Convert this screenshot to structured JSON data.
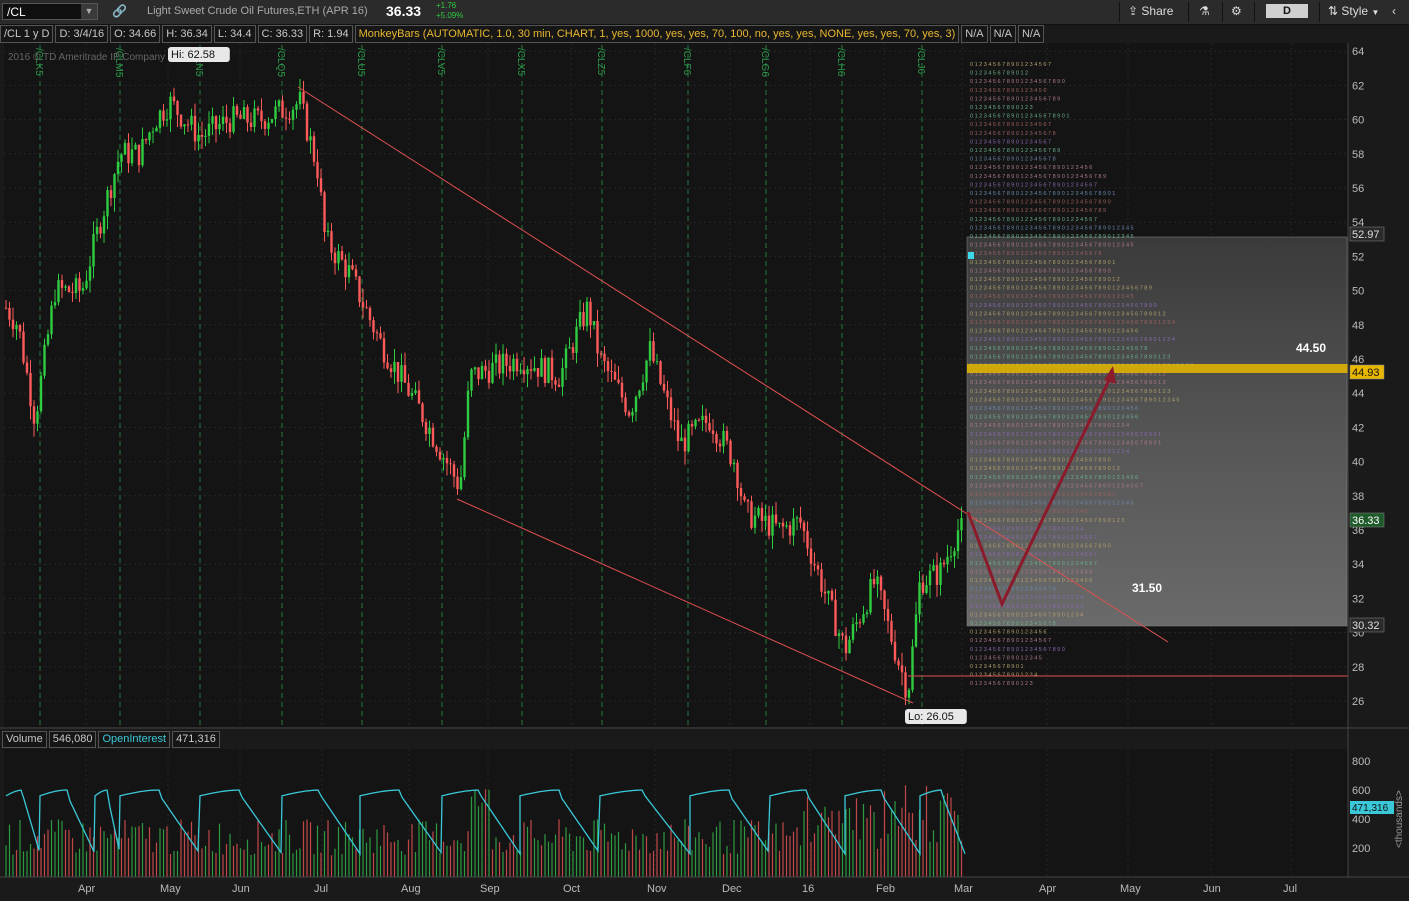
{
  "toolbar": {
    "symbol": "/CL",
    "description": "Light Sweet Crude Oil Futures,ETH (APR 16)",
    "last": "36.33",
    "change": "+1.76",
    "change_pct": "+5.09%",
    "share_label": "Share",
    "aggregation": "D",
    "style_label": "Style"
  },
  "header": {
    "symbol_period": "/CL 1 y D",
    "date": "D: 3/4/16",
    "open": "O: 34.66",
    "high": "H: 36.34",
    "low": "L: 34.4",
    "close": "C: 36.33",
    "range": "R: 1.94",
    "study": "MonkeyBars (AUTOMATIC, 1.0, 30 min, CHART, 1, yes, 1000, yes, yes, 70, 100, no, yes, yes, NONE, yes, yes, 70, yes, 3)",
    "na1": "N/A",
    "na2": "N/A",
    "na3": "N/A"
  },
  "copyright": "2016 © TD Ameritrade IP Company",
  "hi_label": "Hi: 62.58",
  "lo_label": "Lo: 26.05",
  "expiry_labels": [
    "/CLK5",
    "/CLM5",
    "/CLN5",
    "/CLQ5",
    "/CLU5",
    "/CLV5",
    "/CLX5",
    "/CLZ5",
    "/CLF6",
    "/CLG6",
    "/CLH6",
    "/CLJ6"
  ],
  "annotations": {
    "upper_target": "44.50",
    "lower_target": "31.50"
  },
  "price_axis": {
    "ticks": [
      "64",
      "62",
      "60",
      "58",
      "56",
      "54",
      "52",
      "50",
      "48",
      "46",
      "44",
      "42",
      "40",
      "38",
      "36",
      "34",
      "32",
      "30",
      "28",
      "26"
    ],
    "markers": {
      "va_high": "52.97",
      "poc": "44.93",
      "last": "36.33",
      "va_low": "30.32"
    }
  },
  "time_axis": [
    "Apr",
    "May",
    "Jun",
    "Jul",
    "Aug",
    "Sep",
    "Oct",
    "Nov",
    "Dec",
    "16",
    "Feb",
    "Mar",
    "Apr",
    "May",
    "Jun",
    "Jul"
  ],
  "volume": {
    "label": "Volume",
    "value": "546,080",
    "oi_label": "OpenInterest",
    "oi_value": "471,316",
    "ticks": [
      "800",
      "600",
      "400",
      "200"
    ],
    "oi_marker": "471,316",
    "unit": "<thousands>"
  },
  "colors": {
    "up": "#2ecc40",
    "down": "#ff5a5a",
    "trend": "#e05050",
    "arrow": "#8b1a2a",
    "poc": "#e8b800",
    "oi": "#3ac8d8"
  }
}
